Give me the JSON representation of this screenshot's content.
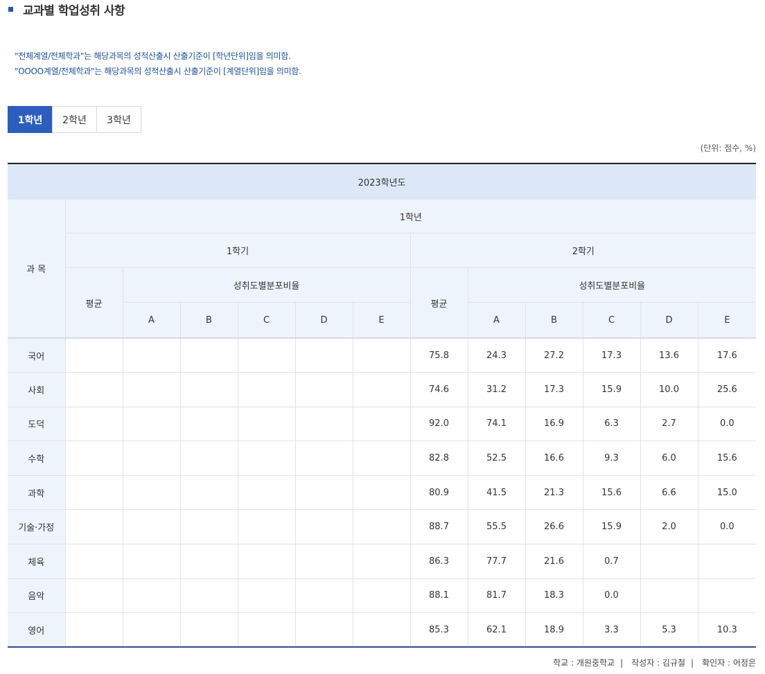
{
  "page": {
    "title": "교과별 학업성취 사항",
    "notes": [
      "\"전체계열/전체학과\"는 해당과목의 성적산출시 산출기준이 [학년단위]임을 의미함.",
      "\"OOOO계열/전체학과\"는 해당과목의 성적산출시 산출기준이 [계열단위]임을 의미함."
    ],
    "unit": "(단위: 점수, %)"
  },
  "tabs": [
    {
      "label": "1학년",
      "active": true
    },
    {
      "label": "2학년",
      "active": false
    },
    {
      "label": "3학년",
      "active": false
    }
  ],
  "table": {
    "year": "2023학년도",
    "grade": "1학년",
    "subject_header": "과 목",
    "semesters": [
      "1학기",
      "2학기"
    ],
    "avg_header": "평균",
    "dist_header": "성취도별분포비율",
    "levels": [
      "A",
      "B",
      "C",
      "D",
      "E"
    ],
    "rows": [
      {
        "subject": "국어",
        "s1": [
          "",
          "",
          "",
          "",
          "",
          ""
        ],
        "s2": [
          "75.8",
          "24.3",
          "27.2",
          "17.3",
          "13.6",
          "17.6"
        ]
      },
      {
        "subject": "사회",
        "s1": [
          "",
          "",
          "",
          "",
          "",
          ""
        ],
        "s2": [
          "74.6",
          "31.2",
          "17.3",
          "15.9",
          "10.0",
          "25.6"
        ]
      },
      {
        "subject": "도덕",
        "s1": [
          "",
          "",
          "",
          "",
          "",
          ""
        ],
        "s2": [
          "92.0",
          "74.1",
          "16.9",
          "6.3",
          "2.7",
          "0.0"
        ]
      },
      {
        "subject": "수학",
        "s1": [
          "",
          "",
          "",
          "",
          "",
          ""
        ],
        "s2": [
          "82.8",
          "52.5",
          "16.6",
          "9.3",
          "6.0",
          "15.6"
        ]
      },
      {
        "subject": "과학",
        "s1": [
          "",
          "",
          "",
          "",
          "",
          ""
        ],
        "s2": [
          "80.9",
          "41.5",
          "21.3",
          "15.6",
          "6.6",
          "15.0"
        ]
      },
      {
        "subject": "기술·가정",
        "s1": [
          "",
          "",
          "",
          "",
          "",
          ""
        ],
        "s2": [
          "88.7",
          "55.5",
          "26.6",
          "15.9",
          "2.0",
          "0.0"
        ]
      },
      {
        "subject": "체육",
        "s1": [
          "",
          "",
          "",
          "",
          "",
          ""
        ],
        "s2": [
          "86.3",
          "77.7",
          "21.6",
          "0.7",
          "",
          ""
        ]
      },
      {
        "subject": "음악",
        "s1": [
          "",
          "",
          "",
          "",
          "",
          ""
        ],
        "s2": [
          "88.1",
          "81.7",
          "18.3",
          "0.0",
          "",
          ""
        ]
      },
      {
        "subject": "영어",
        "s1": [
          "",
          "",
          "",
          "",
          "",
          ""
        ],
        "s2": [
          "85.3",
          "62.1",
          "18.9",
          "3.3",
          "5.3",
          "10.3"
        ]
      }
    ]
  },
  "footer": {
    "school": "학교 : 개원중학교",
    "author": "작성자 : 김규철",
    "checker": "확인자 : 어정은",
    "separator": "|"
  }
}
